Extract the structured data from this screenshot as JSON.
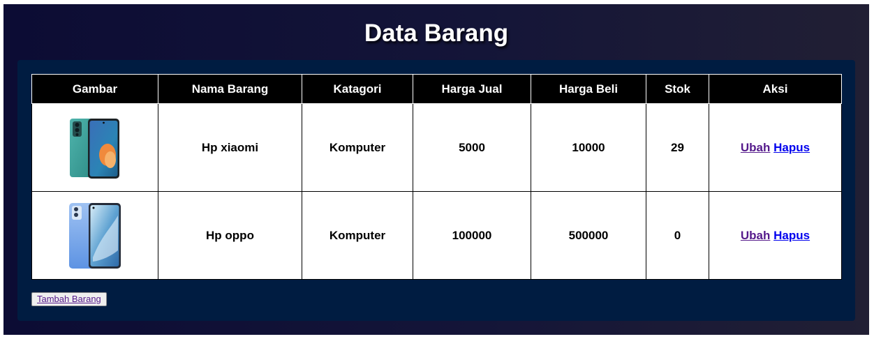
{
  "page": {
    "title": "Data Barang"
  },
  "table": {
    "columns": [
      "Gambar",
      "Nama Barang",
      "Katagori",
      "Harga Jual",
      "Harga Beli",
      "Stok",
      "Aksi"
    ],
    "rows": [
      {
        "image": "phone-teal-image",
        "nama": "Hp xiaomi",
        "katagori": "Komputer",
        "harga_jual": "5000",
        "harga_beli": "10000",
        "stok": "29",
        "ubah": "Ubah",
        "hapus": "Hapus"
      },
      {
        "image": "phone-blue-image",
        "nama": "Hp oppo",
        "katagori": "Komputer",
        "harga_jual": "100000",
        "harga_beli": "500000",
        "stok": "0",
        "ubah": "Ubah",
        "hapus": "Hapus"
      }
    ]
  },
  "actions": {
    "add_label": "Tambah Barang"
  },
  "colors": {
    "background": "#0c0c34",
    "panel": "#001c41",
    "header": "#000000",
    "visited_link": "#551a8b",
    "link": "#0000ee"
  }
}
